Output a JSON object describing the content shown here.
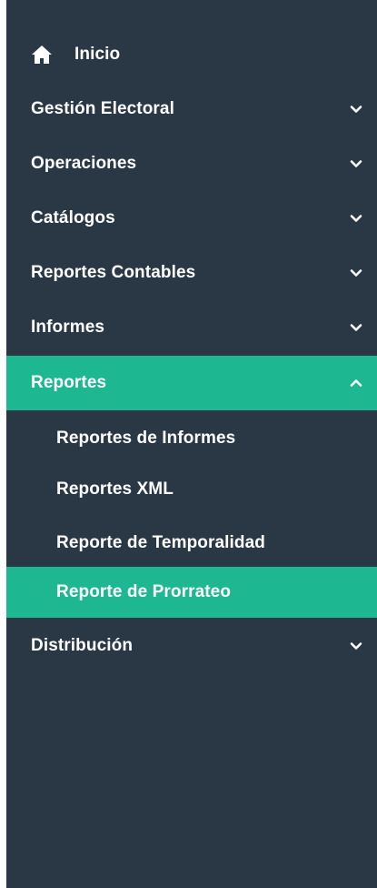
{
  "nav": {
    "home": {
      "label": "Inicio",
      "icon": "home-icon"
    },
    "items": [
      {
        "label": "Gestión Electoral",
        "expanded": false
      },
      {
        "label": "Operaciones",
        "expanded": false
      },
      {
        "label": "Catálogos",
        "expanded": false
      },
      {
        "label": "Reportes Contables",
        "expanded": false
      },
      {
        "label": "Informes",
        "expanded": false
      },
      {
        "label": "Reportes",
        "expanded": true,
        "active": true
      },
      {
        "label": "Distribución",
        "expanded": false
      }
    ],
    "reportes_submenu": [
      {
        "label": "Reportes de Informes"
      },
      {
        "label": "Reportes XML"
      },
      {
        "label": "Reporte de Temporalidad"
      },
      {
        "label": "Reporte de Prorrateo",
        "active": true
      }
    ]
  },
  "colors": {
    "sidebar_bg": "#2a3845",
    "active_bg": "#1db792",
    "text": "#ffffff"
  }
}
